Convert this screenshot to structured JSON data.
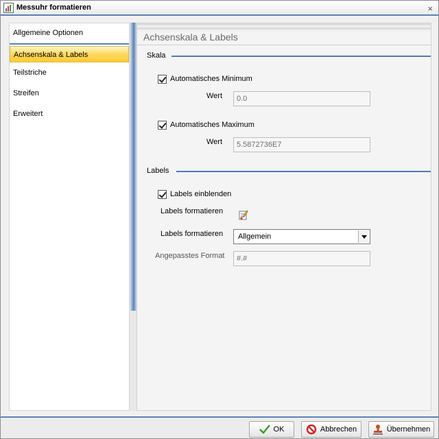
{
  "window": {
    "title": "Messuhr formatieren",
    "close_glyph": "×"
  },
  "nav": {
    "items": [
      {
        "label": "Allgemeine Optionen",
        "selected": false
      },
      {
        "label": "Achsenskala & Labels",
        "selected": true
      },
      {
        "label": "Teilstriche",
        "selected": false
      },
      {
        "label": "Streifen",
        "selected": false
      },
      {
        "label": "Erweitert",
        "selected": false
      }
    ]
  },
  "content": {
    "heading": "Achsenskala & Labels",
    "scale": {
      "title": "Skala",
      "auto_min": {
        "label": "Automatisches Minimum",
        "checked": true
      },
      "min_value_label": "Wert",
      "min_value": "0.0",
      "auto_max": {
        "label": "Automatisches Maximum",
        "checked": true
      },
      "max_value_label": "Wert",
      "max_value": "5.5872736E7"
    },
    "labels": {
      "title": "Labels",
      "show": {
        "label": "Labels einblenden",
        "checked": true
      },
      "format_icon_label": "Labels formatieren",
      "format_select_label": "Labels formatieren",
      "format_select_value": "Allgemein",
      "custom_format_label": "Angepasstes Format",
      "custom_format_value": "#.#"
    }
  },
  "footer": {
    "ok": "OK",
    "cancel": "Abbrechen",
    "apply": "Übernehmen"
  },
  "colors": {
    "accent": "#4f79b6",
    "selected": "#ffd75a"
  }
}
